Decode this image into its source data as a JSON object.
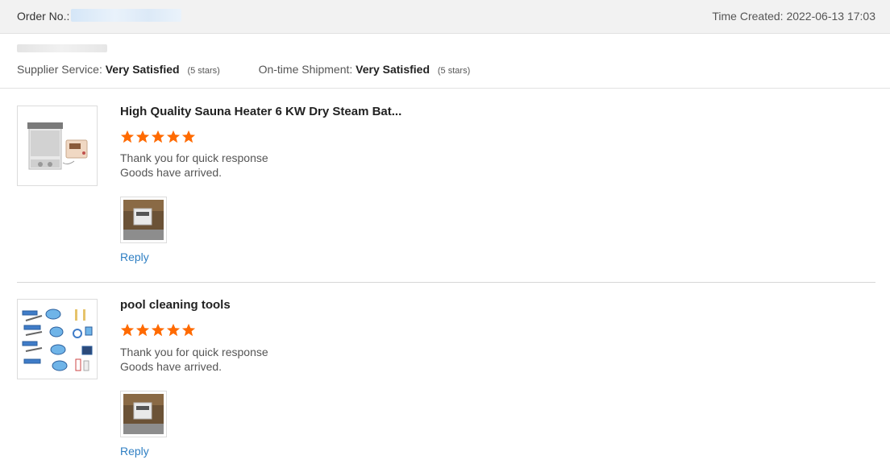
{
  "header": {
    "order_label": "Order No.:",
    "time_label": "Time Created:",
    "time_value": "2022-06-13 17:03"
  },
  "ratings": {
    "supplier_label": "Supplier Service:",
    "supplier_value": "Very Satisfied",
    "supplier_stars": "(5 stars)",
    "shipment_label": "On-time Shipment:",
    "shipment_value": "Very Satisfied",
    "shipment_stars": "(5 stars)"
  },
  "reviews": [
    {
      "title": "High Quality Sauna Heater 6 KW Dry Steam Bat...",
      "rating": 5,
      "comment_line1": "Thank you for quick response",
      "comment_line2": "Goods have arrived.",
      "reply_label": "Reply"
    },
    {
      "title": "pool cleaning tools",
      "rating": 5,
      "comment_line1": "Thank you for quick response",
      "comment_line2": "Goods have arrived.",
      "reply_label": "Reply"
    }
  ],
  "colors": {
    "star": "#ff6a00",
    "link": "#2f7fc3",
    "header_bg": "#f2f2f2"
  }
}
